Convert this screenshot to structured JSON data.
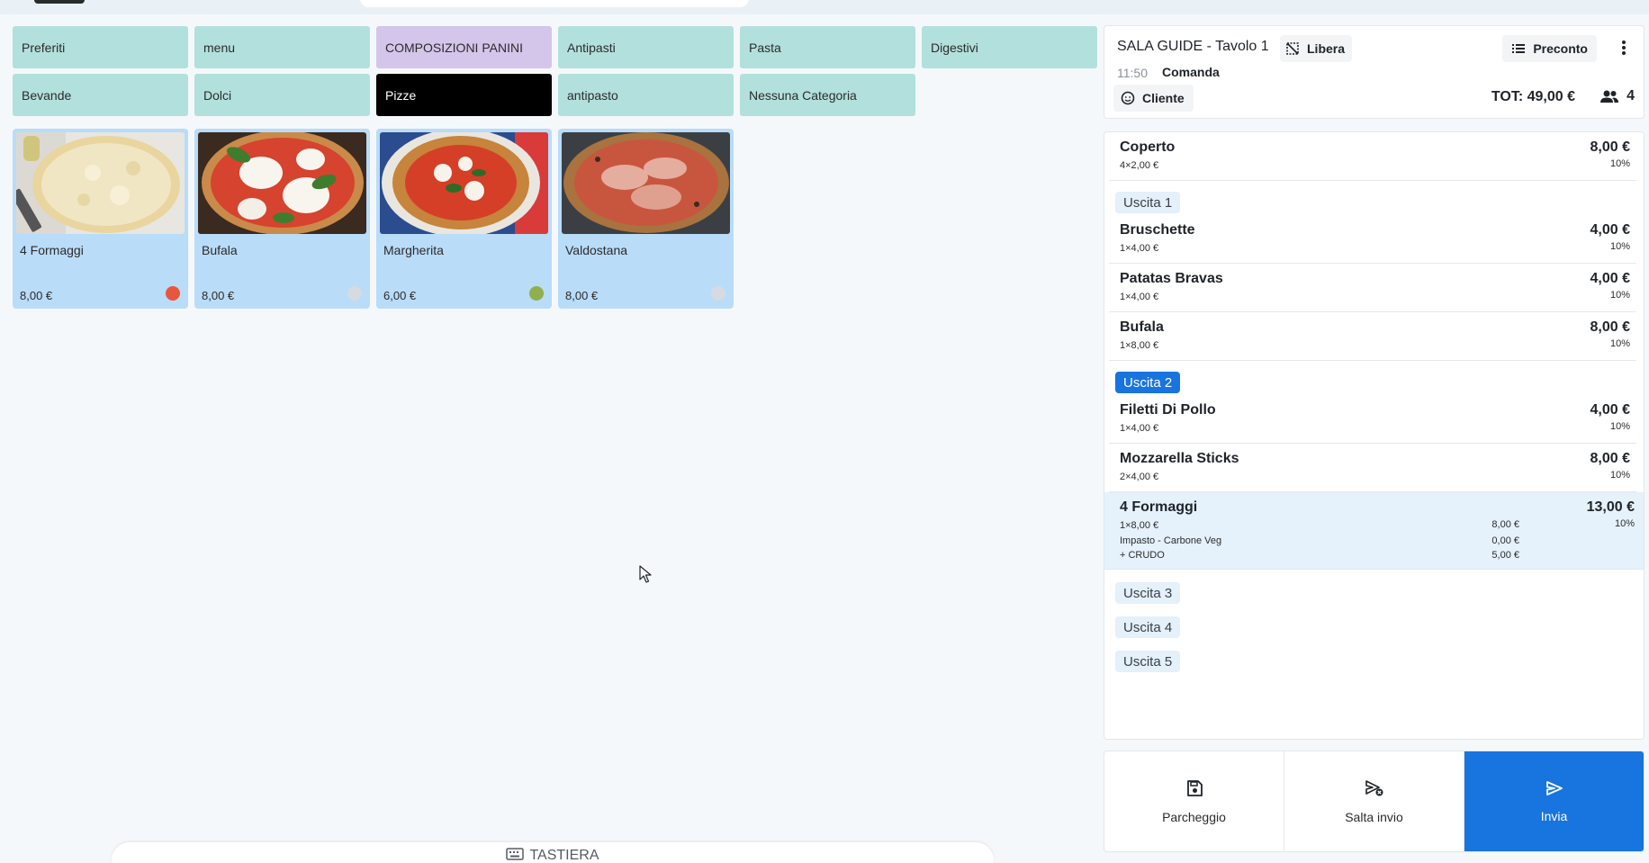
{
  "categories": {
    "row1": [
      {
        "label": "Preferiti",
        "style": "normal"
      },
      {
        "label": "menu",
        "style": "normal"
      },
      {
        "label": "COMPOSIZIONI PANINI",
        "style": "violet"
      },
      {
        "label": "Antipasti",
        "style": "normal"
      },
      {
        "label": "Pasta",
        "style": "normal"
      },
      {
        "label": "Digestivi",
        "style": "normal"
      }
    ],
    "row2": [
      {
        "label": "Bevande",
        "style": "normal"
      },
      {
        "label": "Dolci",
        "style": "normal"
      },
      {
        "label": "Pizze",
        "style": "active"
      },
      {
        "label": "antipasto",
        "style": "normal"
      },
      {
        "label": "Nessuna Categoria",
        "style": "normal"
      }
    ]
  },
  "products": [
    {
      "name": "4 Formaggi",
      "price": "8,00 €",
      "dot_color": "#e8563b"
    },
    {
      "name": "Bufala",
      "price": "8,00 €",
      "dot_color": "#d6dbe0"
    },
    {
      "name": "Margherita",
      "price": "6,00 €",
      "dot_color": "#8fb04d"
    },
    {
      "name": "Valdostana",
      "price": "8,00 €",
      "dot_color": "#d6dbe0"
    }
  ],
  "order": {
    "title": "SALA GUIDE - Tavolo 1",
    "status": "Libera",
    "time": "11:50",
    "mode": "Comanda",
    "cliente": "Cliente",
    "total": "TOT: 49,00 €",
    "covers": "4",
    "preconto": "Preconto"
  },
  "lines": {
    "coperto": {
      "name": "Coperto",
      "qty": "4×2,00 €",
      "total": "8,00 €",
      "vat": "10%"
    },
    "bruschette": {
      "name": "Bruschette",
      "qty": "1×4,00 €",
      "total": "4,00 €",
      "vat": "10%"
    },
    "patatas": {
      "name": "Patatas Bravas",
      "qty": "1×4,00 €",
      "total": "4,00 €",
      "vat": "10%"
    },
    "bufala": {
      "name": "Bufala",
      "qty": "1×8,00 €",
      "total": "8,00 €",
      "vat": "10%"
    },
    "filetti": {
      "name": "Filetti Di Pollo",
      "qty": "1×4,00 €",
      "total": "4,00 €",
      "vat": "10%"
    },
    "mozzarella": {
      "name": "Mozzarella Sticks",
      "qty": "2×4,00 €",
      "total": "8,00 €",
      "vat": "10%"
    },
    "formaggi": {
      "name": "4 Formaggi",
      "qty": "1×8,00 €",
      "qty_price": "8,00 €",
      "total": "13,00 €",
      "vat": "10%",
      "mod1": "Impasto - Carbone Veg",
      "mod1_price": "0,00 €",
      "mod2": "+ CRUDO",
      "mod2_price": "5,00 €"
    }
  },
  "uscite": [
    "Uscita 1",
    "Uscita 2",
    "Uscita 3",
    "Uscita 4",
    "Uscita 5"
  ],
  "actions": {
    "park": "Parcheggio",
    "skip": "Salta invio",
    "send": "Invia"
  },
  "keyboard": "TASTIERA"
}
